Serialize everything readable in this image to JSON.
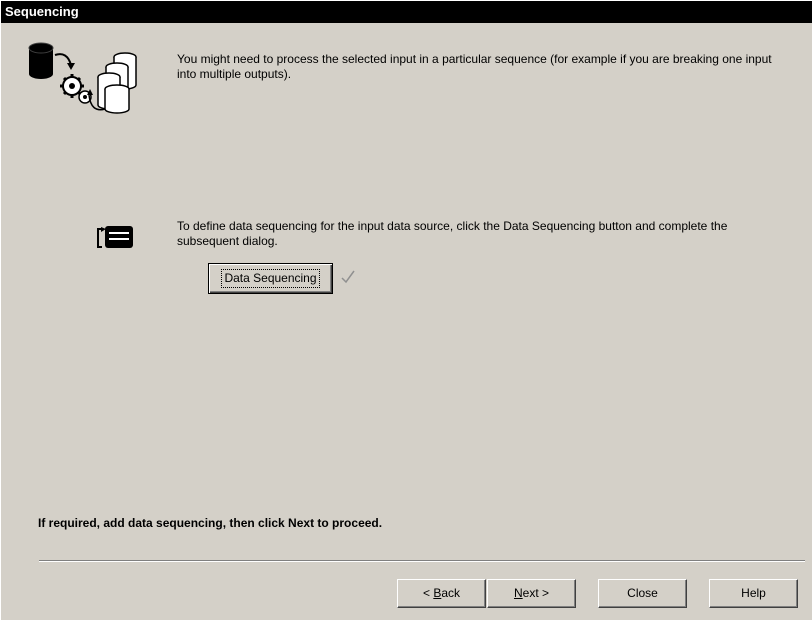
{
  "window": {
    "title": "Sequencing"
  },
  "intro": {
    "text": "You might need to process the selected input in a particular sequence (for example if you are breaking one input into multiple outputs).",
    "icon": "database-sequence-icon"
  },
  "sequencing": {
    "text": "To define data sequencing for the input data source, click the Data Sequencing button and  complete the subsequent dialog.",
    "icon": "sequence-list-icon",
    "button_label": "Data Sequencing",
    "check_icon": "checkmark-icon"
  },
  "instruction": "If required, add data sequencing, then click Next to proceed.",
  "buttons": {
    "back_prefix": "< ",
    "back_mnemonic": "B",
    "back_rest": "ack",
    "next_mnemonic": "N",
    "next_rest": "ext >",
    "close": "Close",
    "help": "Help"
  }
}
